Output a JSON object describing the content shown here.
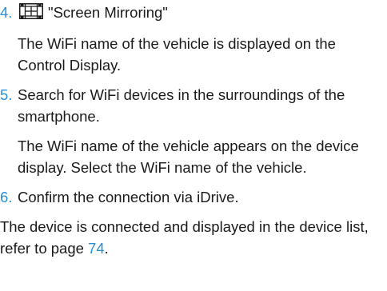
{
  "steps": [
    {
      "number": "4.",
      "text": "\"Screen Mirroring\"",
      "icon": "screen-mirroring-icon",
      "note": "The WiFi name of the vehicle is displayed on the Control Display."
    },
    {
      "number": "5.",
      "text": "Search for WiFi devices in the surroundings of the smartphone.",
      "note": "The WiFi name of the vehicle appears on the device display. Select the WiFi name of the vehicle."
    },
    {
      "number": "6.",
      "text": "Confirm the connection via iDrive."
    }
  ],
  "final": {
    "text": "The device is connected and displayed in the device list, refer to page ",
    "page_link": "74",
    "end": "."
  },
  "colors": {
    "accent": "#2b8fd6",
    "text": "#1a1a1a"
  }
}
